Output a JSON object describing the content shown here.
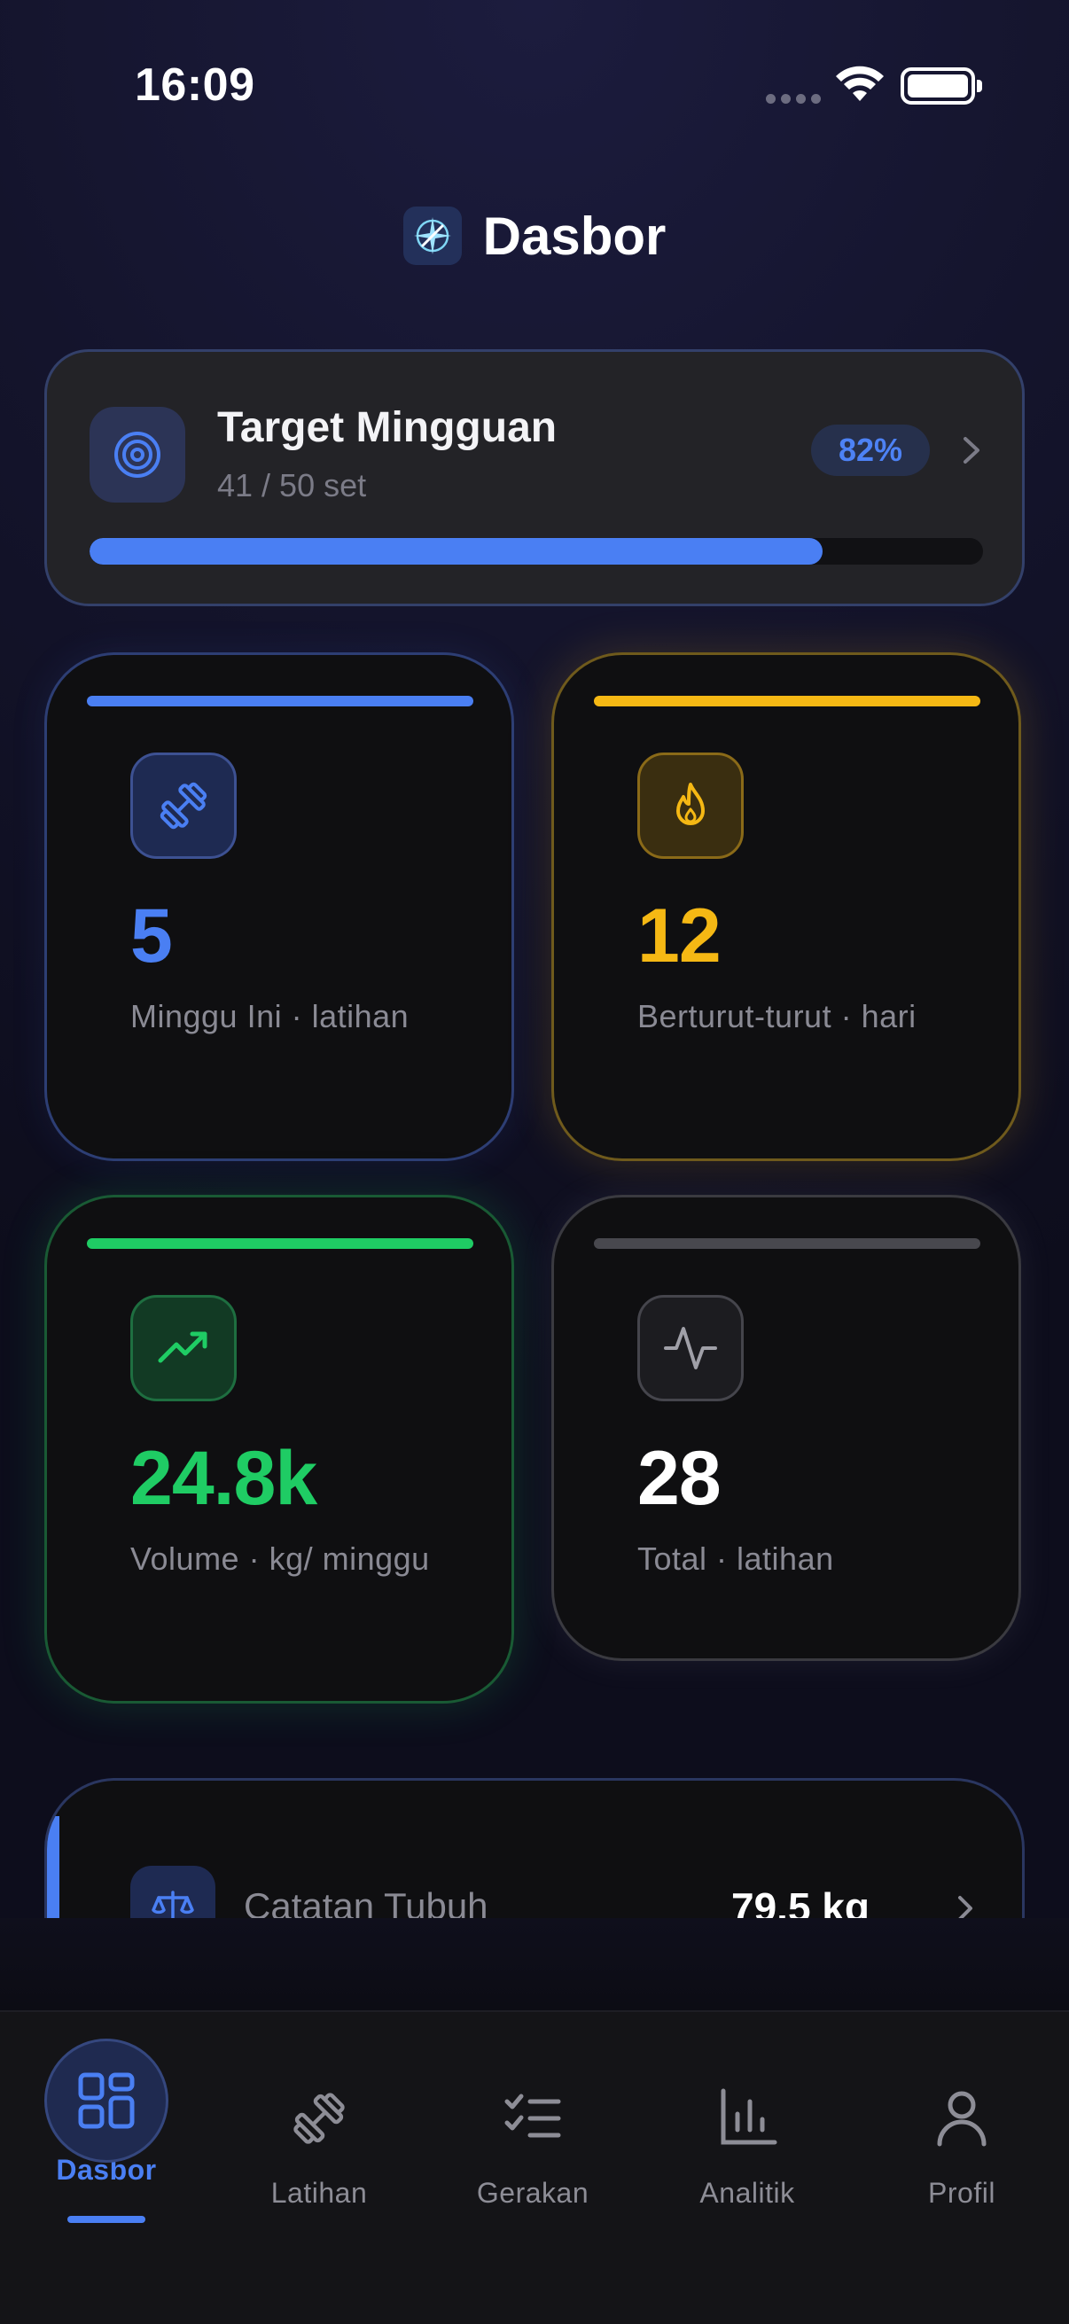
{
  "status_bar": {
    "time": "16:09"
  },
  "header": {
    "title": "Dasbor"
  },
  "weekly_target": {
    "title": "Target Mingguan",
    "progress_text": "41 / 50 set",
    "percent_label": "82%",
    "progress_fraction": 0.82,
    "accent_color": "#4a7ff3"
  },
  "stats": [
    {
      "value": "5",
      "label": "Minggu Ini · latihan",
      "icon": "dumbbell-icon",
      "color": "#4a7ff3"
    },
    {
      "value": "12",
      "label": "Berturut-turut · hari",
      "icon": "flame-icon",
      "color": "#f5b814"
    },
    {
      "value": "24.8k",
      "label": "Volume · kg/ minggu",
      "icon": "trending-up-icon",
      "color": "#1fcc64"
    },
    {
      "value": "28",
      "label": "Total · latihan",
      "icon": "activity-icon",
      "color": "#ffffff"
    }
  ],
  "body_record": {
    "label": "Catatan Tubuh",
    "value": "79.5 kg",
    "icon": "scale-icon"
  },
  "tabs": [
    {
      "label": "Dasbor",
      "icon": "dashboard-icon",
      "active": true
    },
    {
      "label": "Latihan",
      "icon": "dumbbell-icon",
      "active": false
    },
    {
      "label": "Gerakan",
      "icon": "checklist-icon",
      "active": false
    },
    {
      "label": "Analitik",
      "icon": "bar-chart-icon",
      "active": false
    },
    {
      "label": "Profil",
      "icon": "user-icon",
      "active": false
    }
  ]
}
